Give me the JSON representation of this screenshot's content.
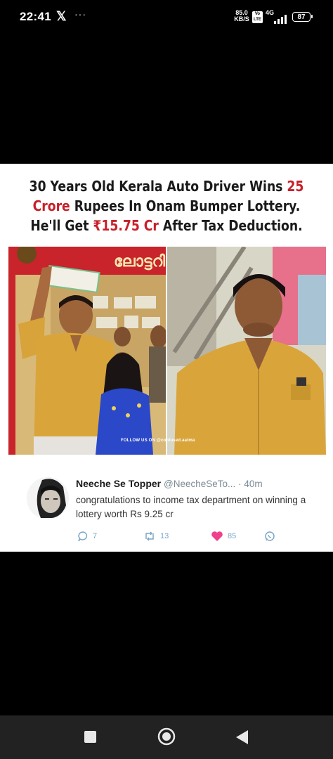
{
  "status_bar": {
    "time": "22:41",
    "x_logo": "𝕏",
    "more": "···",
    "speed_value": "85.0",
    "speed_unit": "KB/S",
    "volte_top": "Vo",
    "volte_bottom": "LTE",
    "network": "4G",
    "battery": "87"
  },
  "post": {
    "headline_line1_a": "30 Years Old Kerala Auto Driver Wins ",
    "headline_line1_b": "25",
    "headline_line2_a": "Crore",
    "headline_line2_b": " Rupees In Onam Bumper Lottery.",
    "headline_line3_a": "He'll Get ",
    "headline_line3_b": "₹15.75 Cr",
    "headline_line3_c": " After Tax Deduction.",
    "shop_sign": "ലോട്ടറി",
    "watermark": "FOLLOW US ON @confused.aatma"
  },
  "tweet": {
    "name": "Neeche Se Topper",
    "handle": "@NeecheSeTo...",
    "time": "· 40m",
    "text": "congratulations to income tax department on winning a lottery worth Rs 9.25 cr",
    "replies": "7",
    "retweets": "13",
    "likes": "85"
  },
  "colors": {
    "accent_red": "#c8202a",
    "like_pink": "#f0408a",
    "action_blue": "#7aa7c8"
  }
}
